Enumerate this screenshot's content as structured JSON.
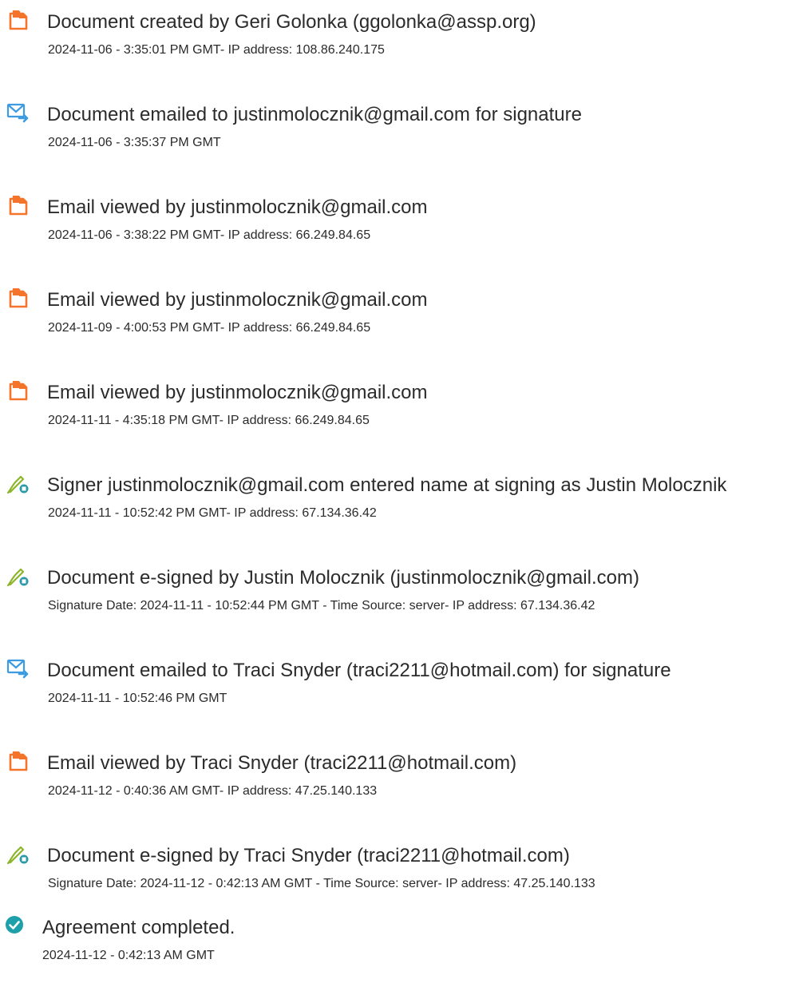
{
  "colors": {
    "document_icon": "#F4742B",
    "email_icon": "#3D9BE2",
    "signature_icon": "#8DB52C",
    "signature_dot": "#2B9AA8",
    "complete_icon": "#1EA0AA",
    "text": "#2b2b2b"
  },
  "events": [
    {
      "icon": "document-icon",
      "title": "Document created by Geri Golonka (ggolonka@assp.org)",
      "detail": "2024-11-06 - 3:35:01 PM GMT- IP address: 108.86.240.175"
    },
    {
      "icon": "email-icon",
      "title": "Document emailed to justinmolocznik@gmail.com for signature",
      "detail": "2024-11-06 - 3:35:37 PM GMT"
    },
    {
      "icon": "document-icon",
      "title": "Email viewed by justinmolocznik@gmail.com",
      "detail": "2024-11-06 - 3:38:22 PM GMT- IP address: 66.249.84.65"
    },
    {
      "icon": "document-icon",
      "title": "Email viewed by justinmolocznik@gmail.com",
      "detail": "2024-11-09 - 4:00:53 PM GMT- IP address: 66.249.84.65"
    },
    {
      "icon": "document-icon",
      "title": "Email viewed by justinmolocznik@gmail.com",
      "detail": "2024-11-11 - 4:35:18 PM GMT- IP address: 66.249.84.65"
    },
    {
      "icon": "signature-icon",
      "title": "Signer justinmolocznik@gmail.com entered name at signing as Justin Molocznik",
      "detail": "2024-11-11 - 10:52:42 PM GMT- IP address: 67.134.36.42"
    },
    {
      "icon": "signature-icon",
      "title": "Document e-signed by Justin Molocznik (justinmolocznik@gmail.com)",
      "detail": "Signature Date: 2024-11-11 - 10:52:44 PM GMT - Time Source: server- IP address: 67.134.36.42"
    },
    {
      "icon": "email-icon",
      "title": "Document emailed to Traci Snyder (traci2211@hotmail.com) for signature",
      "detail": "2024-11-11 - 10:52:46 PM GMT"
    },
    {
      "icon": "document-icon",
      "title": "Email viewed by Traci Snyder (traci2211@hotmail.com)",
      "detail": "2024-11-12 - 0:40:36 AM GMT- IP address: 47.25.140.133"
    },
    {
      "icon": "signature-icon",
      "title": "Document e-signed by Traci Snyder (traci2211@hotmail.com)",
      "detail": "Signature Date: 2024-11-12 - 0:42:13 AM GMT - Time Source: server- IP address: 47.25.140.133"
    },
    {
      "icon": "check-circle-icon",
      "title": "Agreement completed.",
      "detail": "2024-11-12 - 0:42:13 AM GMT"
    }
  ]
}
